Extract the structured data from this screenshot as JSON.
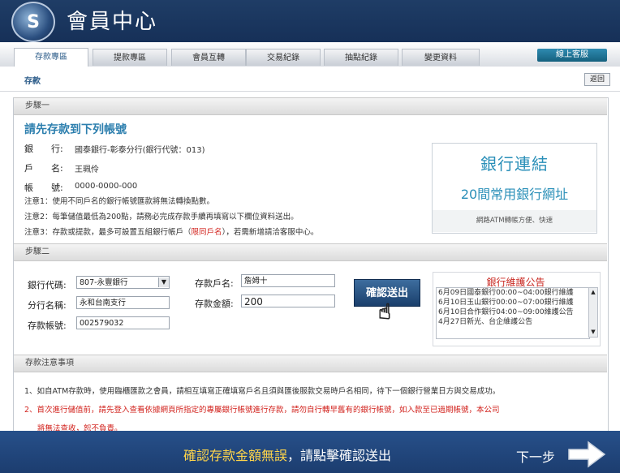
{
  "header": {
    "title": "會員中心",
    "logo_text": "S"
  },
  "nav": {
    "tabs": [
      "存款專區",
      "提款專區",
      "會員互轉",
      "交易紀錄",
      "抽點紀錄",
      "變更資料"
    ],
    "active_tab": 0,
    "service_button": "線上客服"
  },
  "subbar": {
    "title": "存款",
    "back_label": "返回"
  },
  "step1": {
    "header": "步驟一",
    "heading": "請先存款到下列帳號",
    "bank_label": "銀　　行:",
    "bank_value": "國泰銀行-彰泰分行(銀行代號：013)",
    "name_label": "戶　　名:",
    "name_value": "王珮伶",
    "account_label": "帳　　號:",
    "account_value": "0000-0000-000",
    "note1": "注意1：使用不同戶名的銀行帳號匯款將無法轉換點數。",
    "note2": "注意2：每筆儲值最低為200點，請務必完成存款手續再填寫以下欄位資料送出。",
    "note3_pre": "注意3：存款或提款，最多可設置五組銀行帳戶（",
    "note3_red": "限同戶名",
    "note3_post": "），若需新增請洽客服中心。"
  },
  "bank_link": {
    "title": "銀行連結",
    "subtitle": "20間常用銀行網址",
    "footer": "網路ATM轉帳方便、快速"
  },
  "step2": {
    "header": "步驟二",
    "bank_code_label": "銀行代碼:",
    "bank_code_value": "807-永豐銀行",
    "branch_label": "分行名稱:",
    "branch_value": "永和台南支行",
    "account_label": "存款帳號:",
    "account_value": "002579032",
    "depositor_label": "存款戶名:",
    "depositor_value": "詹姆十",
    "amount_label": "存款金額:",
    "amount_value": "200",
    "confirm_button": "確認送出"
  },
  "maintenance": {
    "title": "銀行維護公告",
    "items": [
      "6月09日國泰銀行00:00~04:00銀行維護",
      "6月10日玉山銀行00:00~07:00銀行維護",
      "6月10日合作銀行04:00~09:00維護公告",
      "4月27日新光、台企維護公告"
    ]
  },
  "notes": {
    "header": "存款注意事項",
    "n1": "1、如自ATM存款時，使用臨櫃匯款之會員，請相互填寫正確填寫戶名且須與匯後服款交易時戶名相同，待下一個銀行營業日方與交易成功。",
    "n2": "2、首次進行儲值前，請先登入查看依據網頁所指定的專屬銀行帳號進行存款，請勿自行轉早舊有的銀行帳號，如入款至已過期帳號，本公司",
    "n2b": "將無法查收，恕不負責。"
  },
  "bottom": {
    "msg_yellow": "確認存款金額無誤",
    "msg_white": "，請點擊確認送出",
    "next_label": "下一步"
  },
  "colors": {
    "header_bg": "#1c3a63",
    "accent": "#2d7fae",
    "warn": "#d2231e"
  }
}
